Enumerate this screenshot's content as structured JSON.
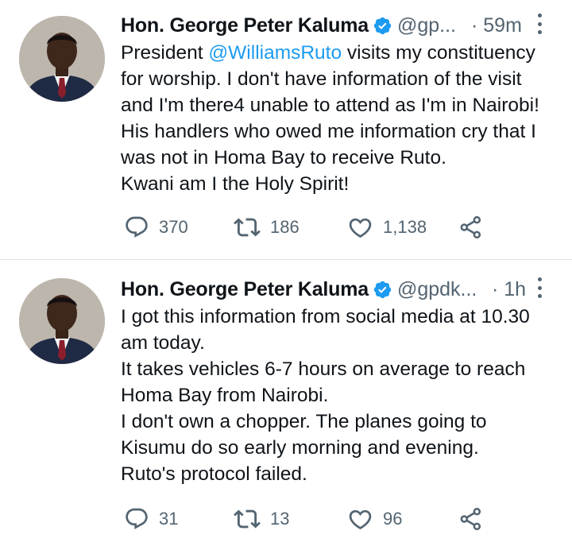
{
  "tweets": [
    {
      "author": {
        "name": "Hon. George Peter Kaluma",
        "handle": "@gp...",
        "verified": true
      },
      "time": "· 59m",
      "text_lines": [
        [
          {
            "t": "President ",
            "mention": false
          },
          {
            "t": "@WilliamsRuto",
            "mention": true
          },
          {
            "t": " visits my constituency",
            "mention": false
          }
        ],
        "for worship. I don't have information of the visit",
        "and I'm there4 unable to attend as I'm in Nairobi!",
        "His handlers who owed me information cry that I",
        "was not in Homa Bay to receive Ruto.",
        "Kwani am I the Holy Spirit!"
      ],
      "stats": {
        "replies": "370",
        "retweets": "186",
        "likes": "1,138"
      }
    },
    {
      "author": {
        "name": "Hon. George Peter Kaluma",
        "handle": "@gpdk...",
        "verified": true
      },
      "time": "· 1h",
      "text_lines": [
        "I got this information from social media at 10.30",
        "am today.",
        "It takes vehicles 6-7 hours on average to reach",
        "Homa Bay from Nairobi.",
        "I don't own a chopper. The planes going to",
        "Kisumu do so early morning and evening.",
        "Ruto's protocol failed."
      ],
      "stats": {
        "replies": "31",
        "retweets": "13",
        "likes": "96"
      }
    }
  ],
  "icons": {
    "reply": "reply-icon",
    "retweet": "retweet-icon",
    "like": "like-icon",
    "share": "share-icon",
    "verified": "verified-badge-icon",
    "more": "more-options-icon"
  },
  "colors": {
    "text": "#0f1419",
    "secondary": "#536471",
    "link": "#1d9bf0",
    "verified": "#1d9bf0",
    "divider": "#dfe3e6"
  }
}
